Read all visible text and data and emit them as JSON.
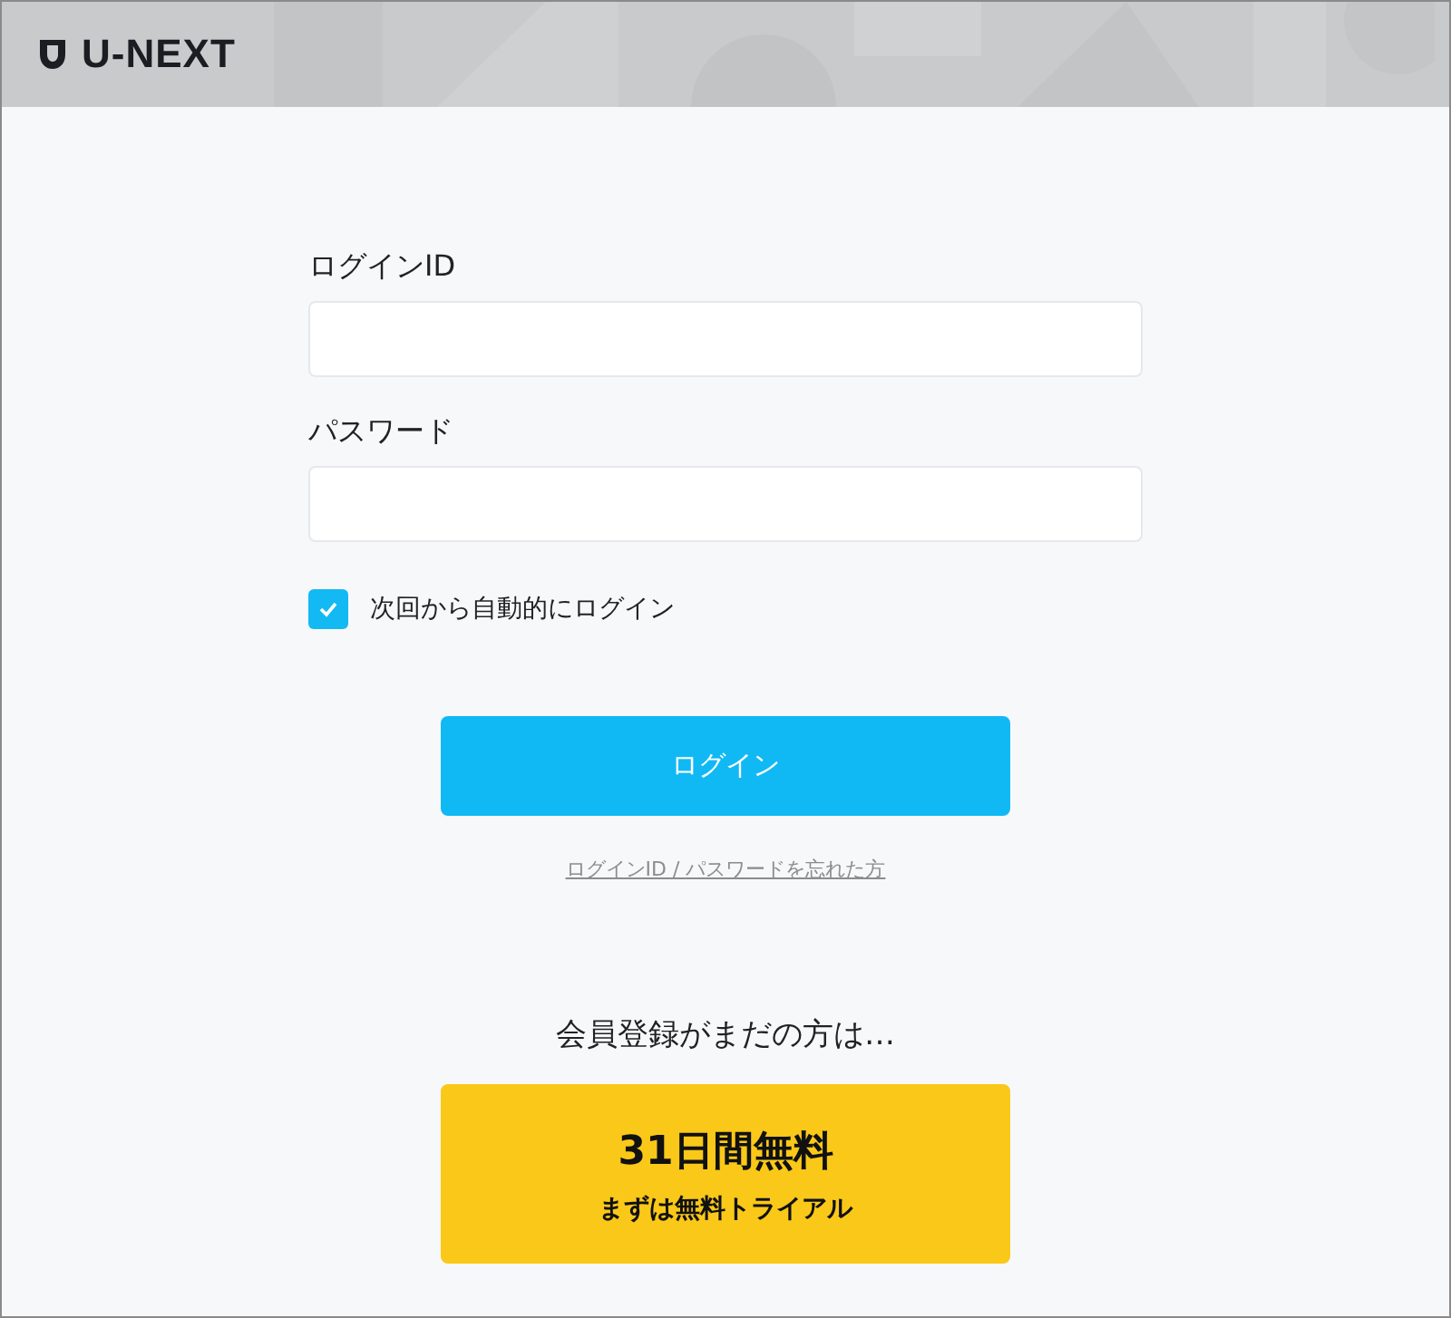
{
  "header": {
    "logo": "U-NEXT"
  },
  "fields": [
    {
      "label": "ログインID"
    },
    {
      "label": "パスワード"
    }
  ],
  "remember": {
    "label": "次回から自動的にログイン",
    "checked": true
  },
  "login_button": "ログイン",
  "forgot_link": "ログインID / パスワードを忘れた方",
  "signup": {
    "prompt": "会員登録がまだの方は…",
    "title": "31日間無料",
    "subtitle": "まずは無料トライアル"
  }
}
